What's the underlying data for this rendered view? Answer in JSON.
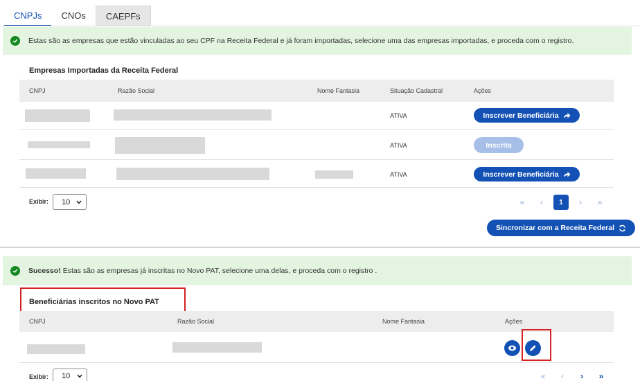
{
  "tabs": [
    {
      "label": "CNPJs"
    },
    {
      "label": "CNOs"
    },
    {
      "label": "CAEPFs"
    }
  ],
  "alert1": {
    "text": "Estas são as empresas que estão vinculadas ao seu CPF na Receita Federal e já foram importadas, selecione uma das empresas importadas, e proceda com o registro."
  },
  "section1": {
    "title": "Empresas Importadas da Receita Federal",
    "columns": [
      "CNPJ",
      "Razão Social",
      "Nome Fantasia",
      "Situação Cadastral",
      "Ações"
    ],
    "rows": [
      {
        "status": "ATIVA",
        "action": "Inscrever Beneficiária"
      },
      {
        "status": "ATIVA",
        "action": "Inscrita"
      },
      {
        "status": "ATIVA",
        "action": "Inscrever Beneficiária"
      }
    ],
    "exibir_label": "Exibir:",
    "exibir_value": "10",
    "pager": {
      "first": "«",
      "prev": "‹",
      "current": "1",
      "next": "›",
      "last": "»"
    },
    "sync_button": "Sincronizar com a Receita Federal"
  },
  "alert2": {
    "strong": "Sucesso!",
    "text": "Estas são as empresas já inscritas no Novo PAT, selecione uma delas, e proceda com o registro ."
  },
  "section2": {
    "title": "Beneficiárias inscritos no Novo PAT",
    "columns": [
      "CNPJ",
      "Razão Social",
      "Nome Fantasia",
      "Ações"
    ],
    "exibir_label": "Exibir:",
    "exibir_value": "10",
    "pager": {
      "first": "«",
      "prev": "‹",
      "next": "›",
      "last": "»"
    }
  },
  "colors": {
    "primary": "#1351b4",
    "success": "#168821",
    "alert_bg": "#e3f5e1",
    "highlight": "#d42020"
  }
}
